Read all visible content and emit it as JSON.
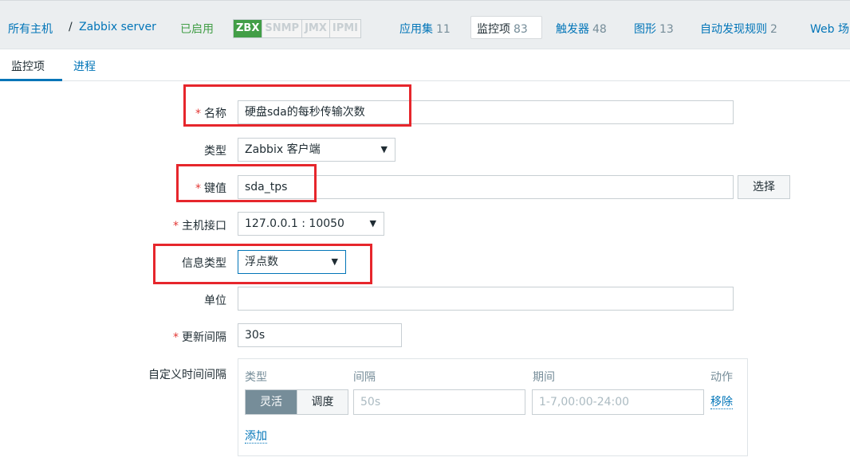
{
  "hostnav": {
    "all_hosts": "所有主机",
    "separator": "/",
    "host": "Zabbix server",
    "status": "已启用",
    "tags": [
      "ZBX",
      "SNMP",
      "JMX",
      "IPMI"
    ],
    "links": [
      {
        "label": "应用集",
        "count": "11"
      },
      {
        "label": "监控项",
        "count": "83"
      },
      {
        "label": "触发器",
        "count": "48"
      },
      {
        "label": "图形",
        "count": "13"
      },
      {
        "label": "自动发现规则",
        "count": "2"
      },
      {
        "label": "Web 场",
        "count": ""
      }
    ]
  },
  "subtabs": [
    "监控项",
    "进程"
  ],
  "form": {
    "name": {
      "label": "名称",
      "required": "*",
      "value": "硬盘sda的每秒传输次数"
    },
    "type": {
      "label": "类型",
      "value": "Zabbix 客户端"
    },
    "key": {
      "label": "键值",
      "required": "*",
      "value": "sda_tps",
      "button": "选择"
    },
    "interface": {
      "label": "主机接口",
      "required": "*",
      "value": "127.0.0.1 : 10050"
    },
    "info_type": {
      "label": "信息类型",
      "value": "浮点数"
    },
    "units": {
      "label": "单位",
      "value": ""
    },
    "update_interval": {
      "label": "更新间隔",
      "required": "*",
      "value": "30s"
    },
    "custom_intervals": {
      "label": "自定义时间间隔",
      "headers": {
        "type": "类型",
        "interval": "间隔",
        "period": "期间",
        "action": "动作"
      },
      "row": {
        "flexible": "灵活",
        "scheduling": "调度",
        "interval_placeholder": "50s",
        "period_placeholder": "1-7,00:00-24:00",
        "remove": "移除"
      },
      "add": "添加"
    }
  },
  "arrow": "▼"
}
